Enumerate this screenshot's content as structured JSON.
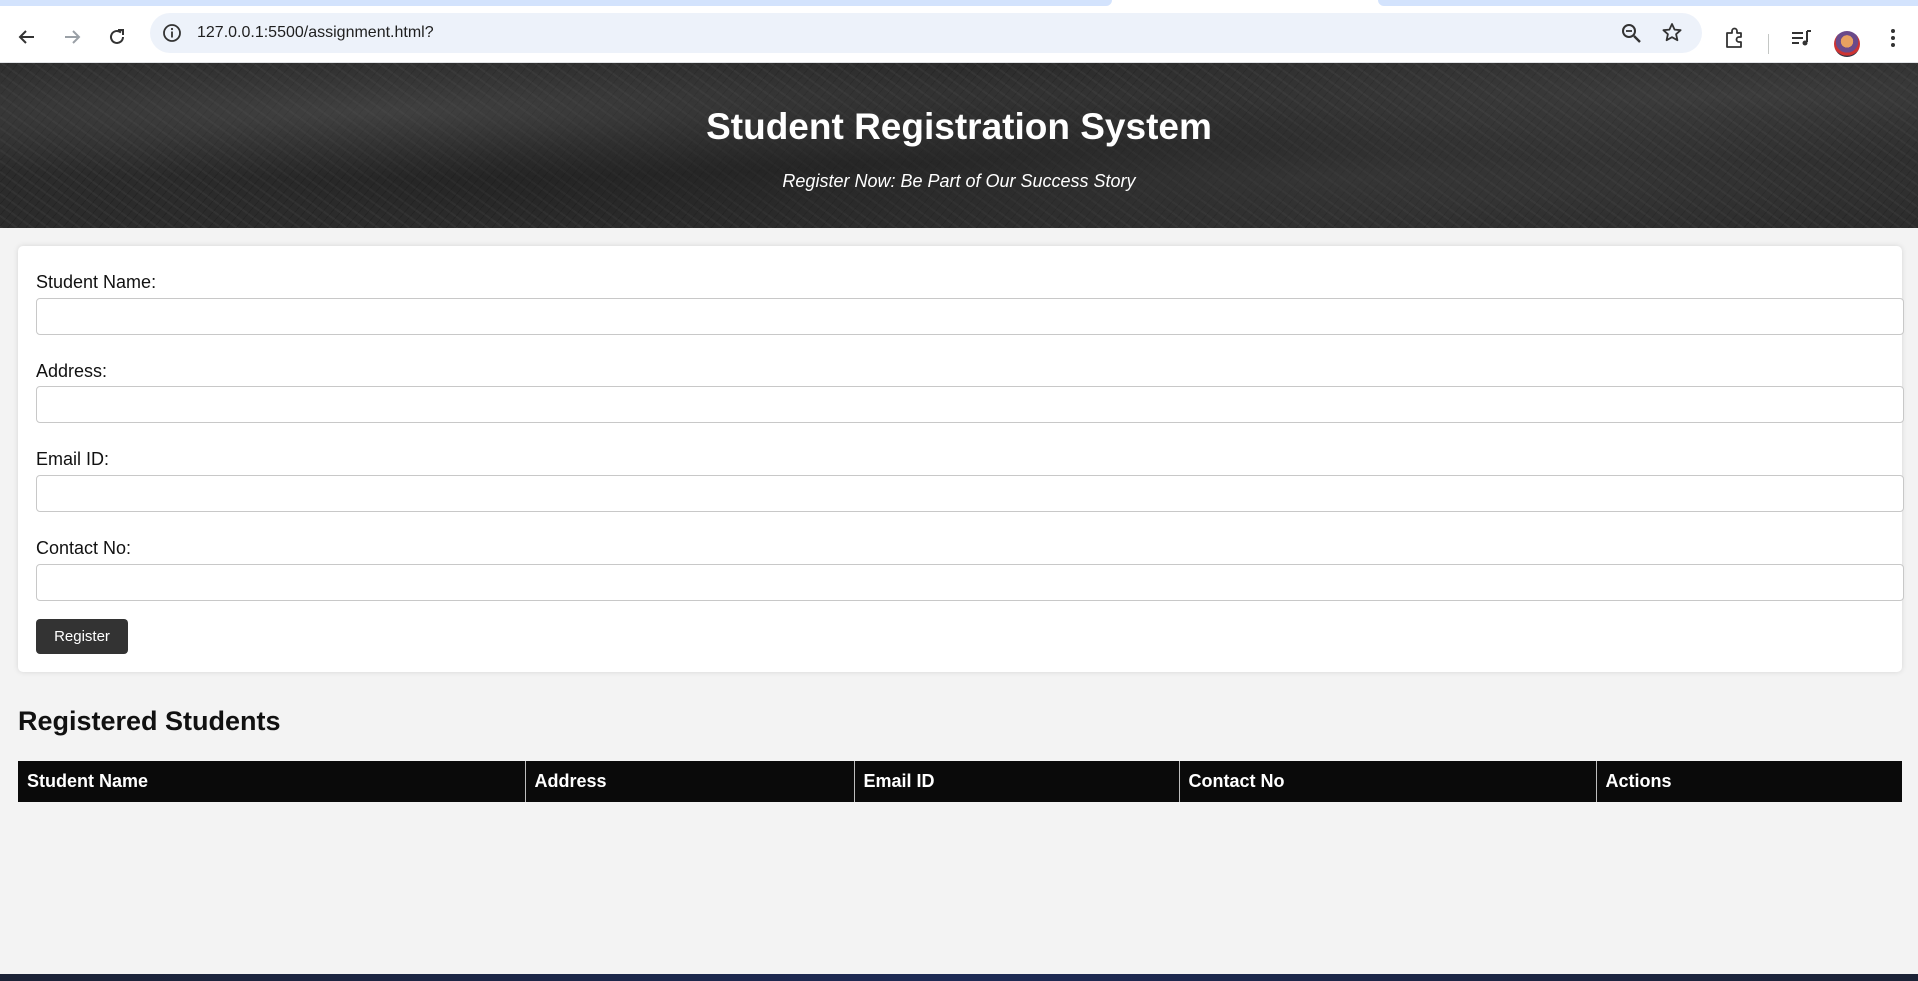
{
  "browser": {
    "url": "127.0.0.1:5500/assignment.html?",
    "icons": [
      "back-arrow-icon",
      "forward-arrow-icon",
      "reload-icon",
      "site-info-icon",
      "zoom-icon",
      "bookmark-star-icon",
      "extensions-puzzle-icon",
      "media-playlist-icon",
      "profile-avatar",
      "kebab-menu-icon"
    ]
  },
  "header": {
    "title": "Student Registration System",
    "subtitle": "Register Now: Be Part of Our Success Story"
  },
  "form": {
    "fields": [
      {
        "label": "Student Name:",
        "value": ""
      },
      {
        "label": "Address:",
        "value": ""
      },
      {
        "label": "Email ID:",
        "value": ""
      },
      {
        "label": "Contact No:",
        "value": ""
      }
    ],
    "submit_label": "Register"
  },
  "table": {
    "title": "Registered Students",
    "columns": [
      "Student Name",
      "Address",
      "Email ID",
      "Contact No",
      "Actions"
    ],
    "rows": []
  }
}
